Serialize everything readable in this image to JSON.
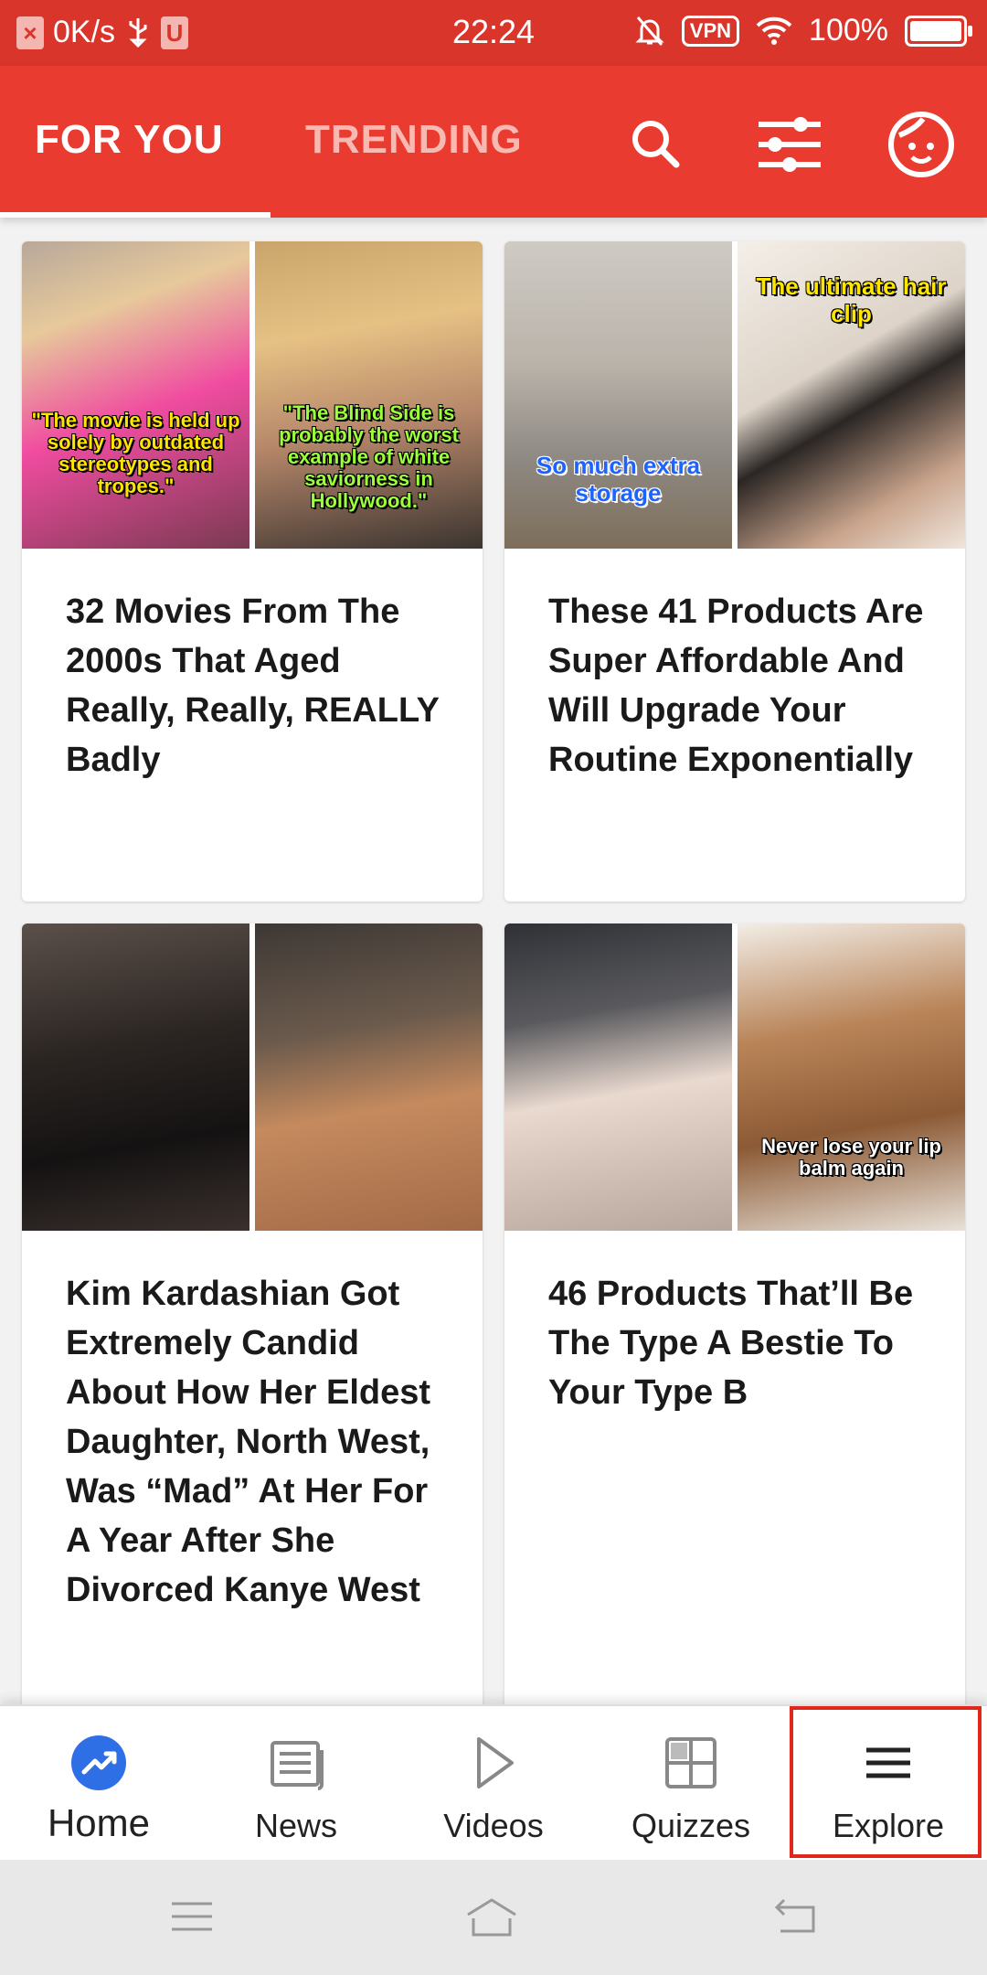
{
  "status_bar": {
    "net_speed": "0K/s",
    "time": "22:24",
    "vpn": "VPN",
    "battery": "100%"
  },
  "header": {
    "tabs": [
      {
        "label": "FOR YOU",
        "active": true
      },
      {
        "label": "TRENDING",
        "active": false
      }
    ],
    "icons": [
      "search-icon",
      "filter-sliders-icon",
      "profile-face-icon"
    ]
  },
  "cards": [
    {
      "title": "32 Movies From The 2000s That Aged Really, Really, REALLY Badly",
      "captions": [
        "\"The movie is held up solely by outdated stereotypes and tropes.\"",
        "\"The Blind Side is probably the worst example of white saviorness in Hollywood.\""
      ]
    },
    {
      "title": "These 41 Products Are Super Affordable And Will Upgrade Your Routine Exponentially",
      "captions": [
        "So much extra storage",
        "The ultimate hair clip"
      ]
    },
    {
      "title": "Kim Kardashian Got Extremely Candid About How Her Eldest Daughter, North West, Was “Mad” At Her For A Year After She Divorced Kanye West",
      "captions": []
    },
    {
      "title": "46 Products That’ll Be The Type A Bestie To Your Type B",
      "captions": [
        "Never lose your lip balm again"
      ]
    }
  ],
  "bottom_nav": [
    {
      "label": "Home",
      "icon": "trending-icon"
    },
    {
      "label": "News",
      "icon": "newspaper-icon"
    },
    {
      "label": "Videos",
      "icon": "play-icon"
    },
    {
      "label": "Quizzes",
      "icon": "grid-icon"
    },
    {
      "label": "Explore",
      "icon": "menu-icon"
    }
  ],
  "colors": {
    "brand": "#e93b2f",
    "highlight": "#e1261c",
    "home_icon": "#2f6fe5"
  }
}
